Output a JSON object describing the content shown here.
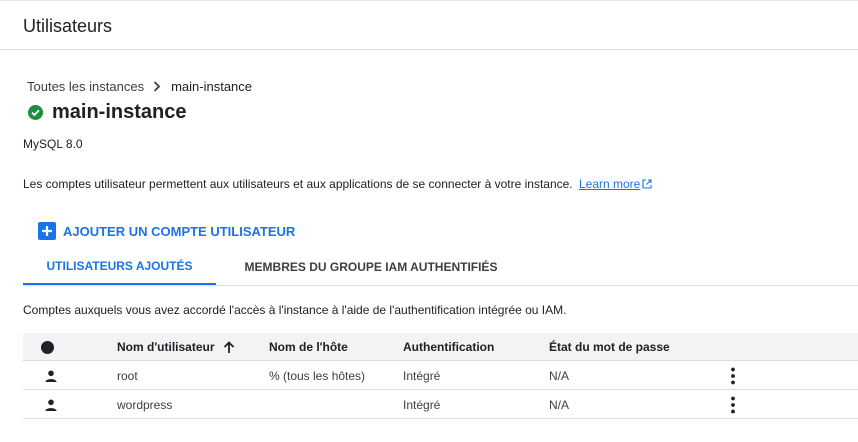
{
  "header": {
    "title": "Utilisateurs"
  },
  "breadcrumb": {
    "parent": "Toutes les instances",
    "current": "main-instance"
  },
  "instance": {
    "name": "main-instance",
    "version": "MySQL 8.0",
    "status_color": "#1e8e3e"
  },
  "description": {
    "text": "Les comptes utilisateur permettent aux utilisateurs et aux applications de se connecter à votre instance.",
    "link_label": "Learn more"
  },
  "add_button": {
    "label": "AJOUTER UN COMPTE UTILISATEUR",
    "icon": "plus-icon"
  },
  "tabs": [
    {
      "label": "UTILISATEURS AJOUTÉS",
      "active": true
    },
    {
      "label": "MEMBRES DU GROUPE IAM AUTHENTIFIÉS",
      "active": false
    }
  ],
  "tab_description": "Comptes auxquels vous avez accordé l'accès à l'instance à l'aide de l'authentification intégrée ou IAM.",
  "table": {
    "columns": [
      "Nom d'utilisateur",
      "Nom de l'hôte",
      "Authentification",
      "État du mot de passe"
    ],
    "sort": {
      "column": "Nom d'utilisateur",
      "direction": "ascending"
    },
    "rows": [
      {
        "username": "root",
        "host": "% (tous les hôtes)",
        "auth": "Intégré",
        "password_state": "N/A"
      },
      {
        "username": "wordpress",
        "host": "",
        "auth": "Intégré",
        "password_state": "N/A"
      }
    ]
  },
  "colors": {
    "accent": "#1a73e8",
    "success": "#1e8e3e",
    "text": "#202124"
  }
}
